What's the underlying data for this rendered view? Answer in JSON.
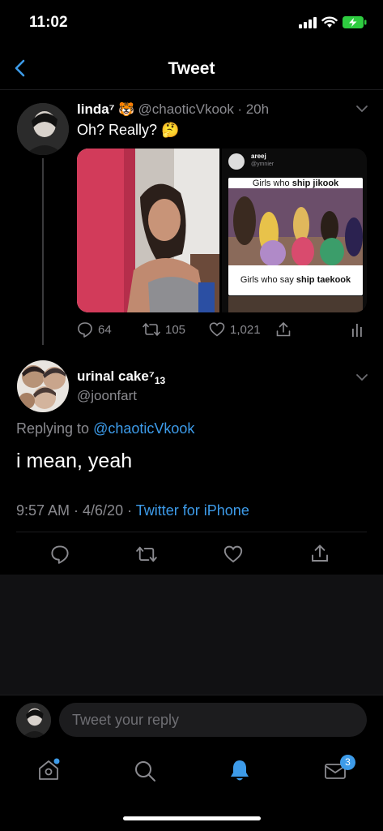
{
  "status": {
    "time": "11:02"
  },
  "header": {
    "title": "Tweet"
  },
  "original_tweet": {
    "name": "linda⁷",
    "emoji": "🐯",
    "handle": "@chaoticVkook",
    "time": "· 20h",
    "text": "Oh? Really? 🤔",
    "embedded": {
      "name": "areej",
      "handle": "@ymnier",
      "caption_top_prefix": "Girls who ",
      "caption_top_bold": "ship jikook",
      "caption_bottom_prefix": "Girls who say ",
      "caption_bottom_bold": "ship taekook"
    },
    "replies": "64",
    "retweets": "105",
    "likes": "1,021"
  },
  "reply_tweet": {
    "name": "urinal cake⁷",
    "name_sub": "13",
    "handle": "@joonfart",
    "replying_prefix": "Replying to ",
    "replying_handle": "@chaoticVkook",
    "text": "i mean, yeah",
    "timestamp": "9:57 AM · 4/6/20 · ",
    "source": "Twitter for iPhone"
  },
  "reply_bar": {
    "placeholder": "Tweet your reply"
  },
  "tabbar": {
    "messages_badge": "3"
  },
  "colors": {
    "accent": "#3d9be9",
    "background": "#000000",
    "muted": "#8a8a8f"
  }
}
